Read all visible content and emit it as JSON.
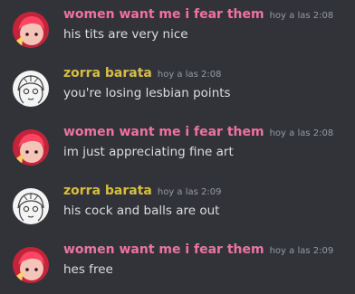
{
  "messages": [
    {
      "author": "women want me i fear them",
      "timestamp": "hoy a las 2:08",
      "text": "his tits are very nice"
    },
    {
      "author": "zorra barata",
      "timestamp": "hoy a las 2:08",
      "text": "you're losing lesbian points"
    },
    {
      "author": "women want me i fear them",
      "timestamp": "hoy a las 2:08",
      "text": "im just appreciating fine art"
    },
    {
      "author": "zorra barata",
      "timestamp": "hoy a las 2:09",
      "text": "his cock and balls are out"
    },
    {
      "author": "women want me i fear them",
      "timestamp": "hoy a las 2:09",
      "text": "hes free"
    }
  ],
  "colors": {
    "background": "#323339",
    "author_pink": "#ee739f",
    "author_yellow": "#d8bd43",
    "message_text": "#dbdee1",
    "timestamp": "#949ba4"
  }
}
